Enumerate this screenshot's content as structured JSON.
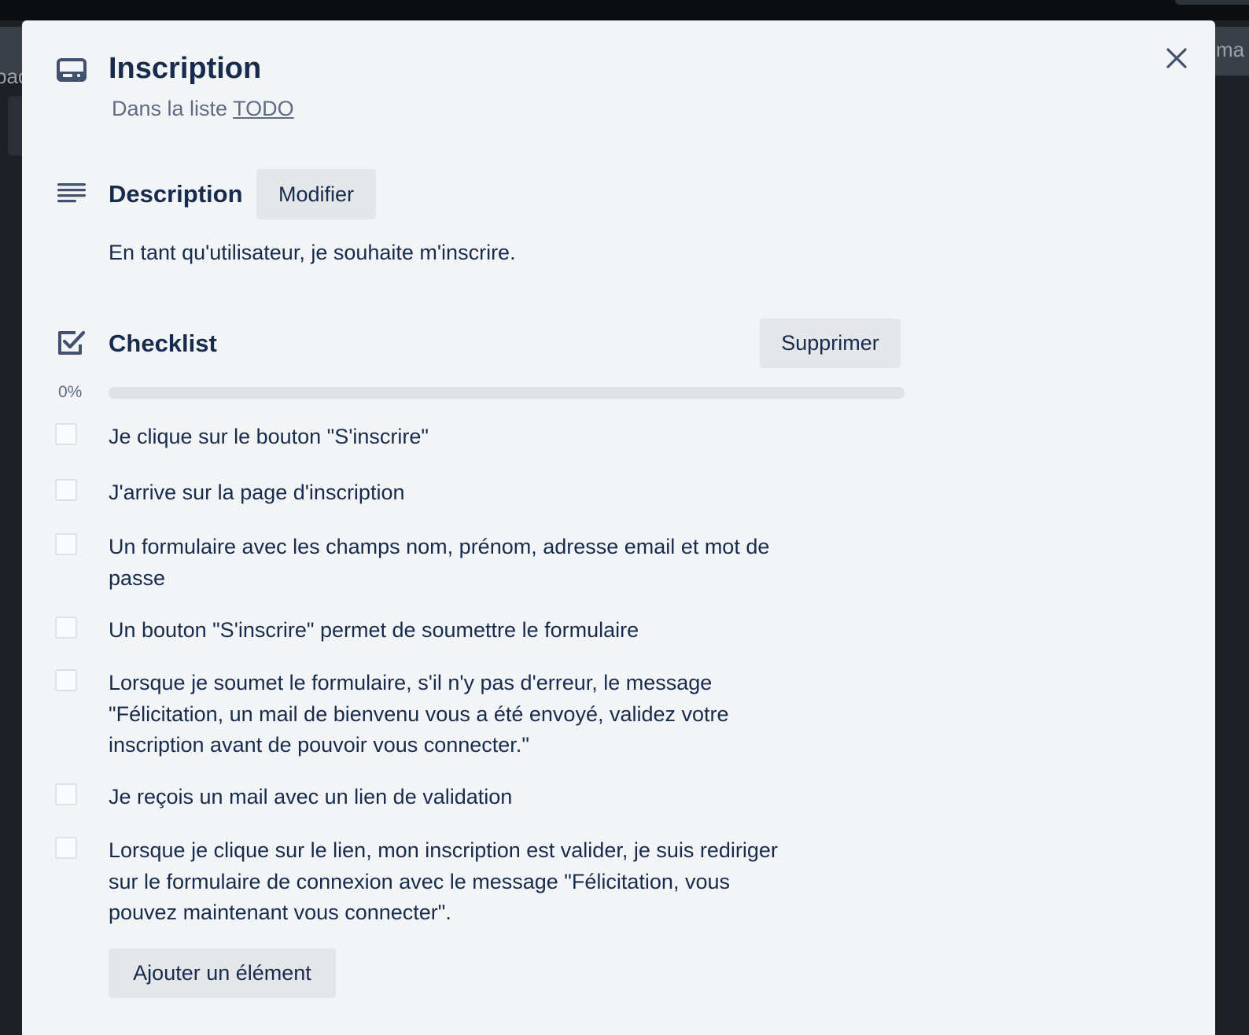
{
  "card": {
    "title": "Inscription",
    "list_prefix": "Dans la liste",
    "list_name": "TODO",
    "icon": "card-icon",
    "close_icon": "close-icon"
  },
  "description": {
    "heading": "Description",
    "edit_label": "Modifier",
    "text": "En tant qu'utilisateur, je souhaite m'inscrire.",
    "icon": "description-icon"
  },
  "checklist": {
    "heading": "Checklist",
    "delete_label": "Supprimer",
    "progress_label": "0%",
    "progress_fraction": 0,
    "icon": "checkbox-icon",
    "add_label": "Ajouter un élément",
    "items": [
      {
        "text": "Je clique sur le bouton \"S'inscrire\"",
        "checked": false
      },
      {
        "text": "J'arrive sur la page d'inscription",
        "checked": false
      },
      {
        "text": "Un formulaire avec les champs nom, prénom, adresse email et mot de passe",
        "checked": false
      },
      {
        "text": "Un bouton \"S'inscrire\" permet de soumettre le formulaire",
        "checked": false
      },
      {
        "text": "Lorsque je soumet le formulaire, s'il n'y pas d'erreur, le message \"Félicitation, un mail de bienvenu vous a été envoyé, validez votre inscription avant de pouvoir vous connecter.\"",
        "checked": false
      },
      {
        "text": "Je reçois un mail avec un lien de validation",
        "checked": false
      },
      {
        "text": "Lorsque je clique sur le lien, mon inscription est valider, je suis rediriger sur le formulaire de connexion avec le message \"Félicitation, vous pouvez maintenant vous connecter\".",
        "checked": false
      }
    ]
  },
  "background": {
    "left_fragment": "pac",
    "right_fragment": "ma"
  },
  "colors": {
    "text_primary": "#172b4d",
    "text_muted": "#5e6c84",
    "modal_bg": "#f3f4f6",
    "button_bg": "#e4e6ea",
    "progress_track": "#dfe1e6"
  }
}
